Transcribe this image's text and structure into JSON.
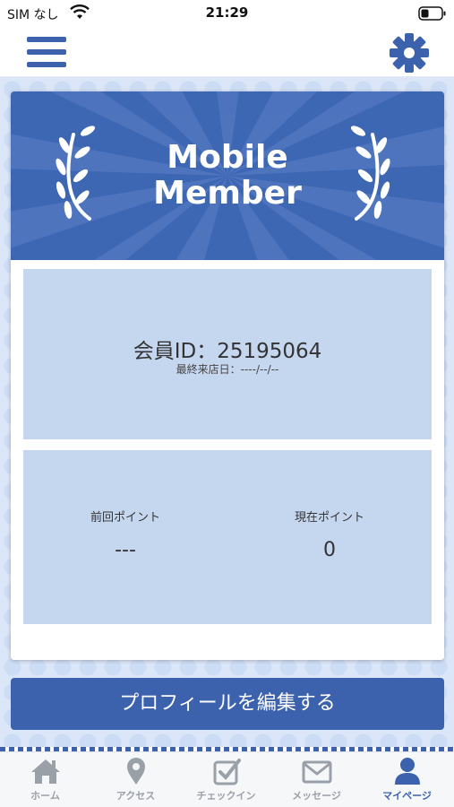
{
  "status_bar": {
    "carrier": "SIM なし",
    "time": "21:29"
  },
  "nav": {
    "menu_icon": "hamburger-menu-icon",
    "settings_icon": "gear-icon"
  },
  "card": {
    "title_line1": "Mobile",
    "title_line2": "Member",
    "member_id": "会員ID：25195064",
    "last_visit": "最終来店日：----/--/--",
    "previous_points_label": "前回ポイント",
    "previous_points_value": "---",
    "current_points_label": "現在ポイント",
    "current_points_value": "0"
  },
  "edit_profile_label": "プロフィールを編集する",
  "tabs": [
    {
      "label": "ホーム",
      "icon": "home-icon",
      "active": false
    },
    {
      "label": "アクセス",
      "icon": "map-pin-icon",
      "active": false
    },
    {
      "label": "チェックイン",
      "icon": "checkbox-icon",
      "active": false
    },
    {
      "label": "メッセージ",
      "icon": "envelope-icon",
      "active": false
    },
    {
      "label": "マイページ",
      "icon": "user-icon",
      "active": true
    }
  ],
  "colors": {
    "brand_blue": "#3d62ad",
    "panel_blue": "#c5d6ef",
    "inactive_tab": "#9aa0a8"
  }
}
